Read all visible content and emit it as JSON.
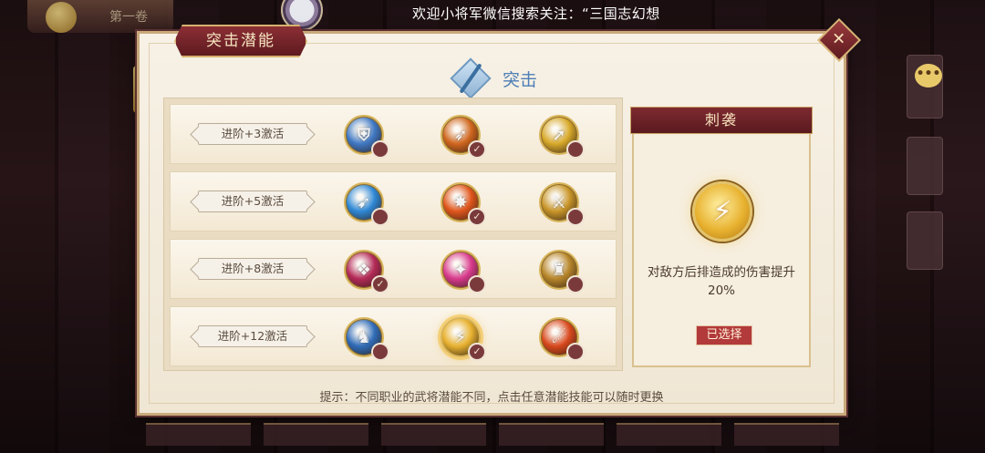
{
  "topbar": {
    "banner_text": "欢迎小将军微信搜索关注：“三国志幻想"
  },
  "background": {
    "top_left_label": "第一卷",
    "chat_icon": "chat-bubble-icon"
  },
  "panel": {
    "title": "突击潜能",
    "close_icon": "close-icon",
    "header": {
      "icon": "sword-diamond-icon",
      "label": "突击"
    },
    "tiers": [
      {
        "label": "进阶+3激活",
        "skills": [
          {
            "icon": "shield-skill-icon",
            "color": "#3f78c4",
            "selected": false
          },
          {
            "icon": "flame-spear-skill-icon",
            "color": "#d0661e",
            "selected": true
          },
          {
            "icon": "golden-spear-skill-icon",
            "color": "#d8a92a",
            "selected": false
          }
        ]
      },
      {
        "label": "进阶+5激活",
        "skills": [
          {
            "icon": "ice-lance-skill-icon",
            "color": "#2f88d6",
            "selected": false
          },
          {
            "icon": "explosion-skill-icon",
            "color": "#e0561c",
            "selected": true
          },
          {
            "icon": "warrior-skill-icon",
            "color": "#c9962a",
            "selected": false
          }
        ]
      },
      {
        "label": "进阶+8激活",
        "skills": [
          {
            "icon": "crimson-beast-skill-icon",
            "color": "#b42a58",
            "selected": true
          },
          {
            "icon": "pink-burst-skill-icon",
            "color": "#d83a8c",
            "selected": false
          },
          {
            "icon": "armored-general-skill-icon",
            "color": "#b8862a",
            "selected": false
          }
        ]
      },
      {
        "label": "进阶+12激活",
        "skills": [
          {
            "icon": "charging-rider-skill-icon",
            "color": "#2f6cb8",
            "selected": false
          },
          {
            "icon": "lightning-strike-skill-icon",
            "color": "#e8b230",
            "selected": true
          },
          {
            "icon": "flame-slash-skill-icon",
            "color": "#d8481c",
            "selected": false
          }
        ]
      }
    ],
    "detail": {
      "title": "刺袭",
      "icon": "lightning-strike-skill-icon",
      "description": "对敌方后排造成的伤害提升20%",
      "status_badge": "已选择"
    },
    "tip": "提示：不同职业的武将潜能不同，点击任意潜能技能可以随时更换"
  },
  "check_icon": "check-icon"
}
